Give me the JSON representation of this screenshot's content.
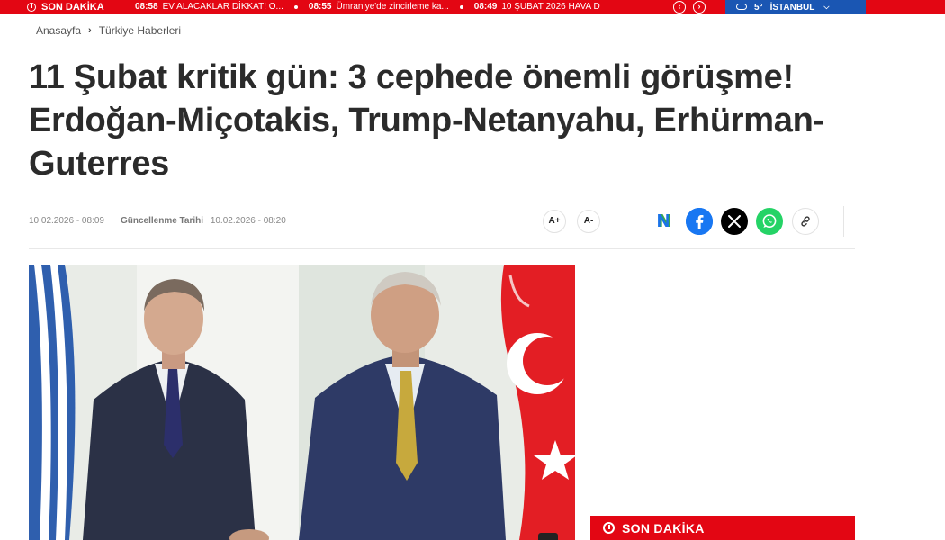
{
  "ticker": {
    "label": "SON DAKİKA",
    "items": [
      {
        "time": "08:58",
        "text": "EV ALACAKLAR DİKKAT! O..."
      },
      {
        "time": "08:55",
        "text": "Ümraniye'de zincirleme ka..."
      },
      {
        "time": "08:49",
        "text": "10 ŞUBAT 2026 HAVA D"
      }
    ],
    "prev_icon": "chevron-left-icon",
    "next_icon": "chevron-right-icon",
    "weather": {
      "temp": "5°",
      "city": "İSTANBUL",
      "icon": "cloud-icon"
    }
  },
  "breadcrumb": {
    "home": "Anasayfa",
    "category": "Türkiye Haberleri"
  },
  "article": {
    "title": "11 Şubat kritik gün: 3 cephede önemli görüşme! Erdoğan-Miçotakis, Trump-Netanyahu, Erhürman-Guterres",
    "published": "10.02.2026 - 08:09",
    "updated_label": "Güncellenme Tarihi",
    "updated": "10.02.2026 - 08:20",
    "font_increase": "A+",
    "font_decrease": "A-"
  },
  "share": {
    "google_news_letter": "N",
    "icons": [
      "google-news-icon",
      "facebook-icon",
      "x-icon",
      "whatsapp-icon",
      "link-icon"
    ]
  },
  "sidebar": {
    "son_dakika_title": "SON DAKİKA"
  },
  "colors": {
    "brand_red": "#e30613",
    "weather_blue": "#1a56b3",
    "facebook": "#1877f2",
    "whatsapp": "#25d366"
  }
}
